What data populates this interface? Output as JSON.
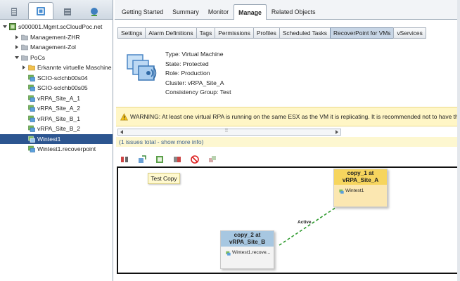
{
  "navigator": {
    "tree": [
      {
        "label": "s000001.Mgmt.scCloudPoc.net",
        "depth": 0,
        "twisty": "open",
        "icon": "vcenter-icon"
      },
      {
        "label": "Management-ZHR",
        "depth": 1,
        "twisty": "closed",
        "icon": "folder-gray-icon"
      },
      {
        "label": "Management-Zol",
        "depth": 1,
        "twisty": "closed",
        "icon": "folder-gray-icon"
      },
      {
        "label": "PoCs",
        "depth": 1,
        "twisty": "open",
        "icon": "folder-gray-icon"
      },
      {
        "label": "Erkannte virtuelle Maschine",
        "depth": 2,
        "twisty": "closed",
        "icon": "folder-yellow-icon"
      },
      {
        "label": "SCIO-sclchb00s04",
        "depth": 2,
        "twisty": "none",
        "icon": "vm-icon"
      },
      {
        "label": "SCIO-sclchb00s05",
        "depth": 2,
        "twisty": "none",
        "icon": "vm-icon"
      },
      {
        "label": "vRPA_Site_A_1",
        "depth": 2,
        "twisty": "none",
        "icon": "vm-icon"
      },
      {
        "label": "vRPA_Site_A_2",
        "depth": 2,
        "twisty": "none",
        "icon": "vm-icon"
      },
      {
        "label": "vRPA_Site_B_1",
        "depth": 2,
        "twisty": "none",
        "icon": "vm-icon"
      },
      {
        "label": "vRPA_Site_B_2",
        "depth": 2,
        "twisty": "none",
        "icon": "vm-icon"
      },
      {
        "label": "Wintest1",
        "depth": 2,
        "twisty": "none",
        "icon": "vm-icon",
        "selected": true
      },
      {
        "label": "Wintest1.recoverpoint",
        "depth": 2,
        "twisty": "none",
        "icon": "vm-icon"
      }
    ]
  },
  "tabs": [
    "Getting Started",
    "Summary",
    "Monitor",
    "Manage",
    "Related Objects"
  ],
  "active_tab": "Manage",
  "subtabs": [
    "Settings",
    "Alarm Definitions",
    "Tags",
    "Permissions",
    "Profiles",
    "Scheduled Tasks",
    "RecoverPoint for VMs",
    "vServices"
  ],
  "active_subtab": "RecoverPoint for VMs",
  "details": {
    "type": "Type:  Virtual Machine",
    "state": "State:  Protected",
    "role": "Role:  Production",
    "cluster": "Cluster:  vRPA_Site_A",
    "group": "Consistency Group:  Test"
  },
  "warning": {
    "text": "WARNING: At least one virtual RPA is running on the same ESX as the VM it is replicating. It is recommended not to have the v",
    "issues": "(1 issues total - show more info)"
  },
  "diagram": {
    "callout": "Test Copy",
    "copy_a": {
      "title_line1": "copy_1 at",
      "title_line2": "vRPA_Site_A",
      "vm": "Wintest1"
    },
    "copy_b": {
      "title_line1": "copy_2 at",
      "title_line2": "vRPA_Site_B",
      "vm": "Wintest1.recove..."
    },
    "link_label": "Active",
    "link_color": "#2e9a2e"
  },
  "colors": {
    "selection": "#2c5590",
    "warning_bg": "#fff6c6",
    "copy_a_header": "#f6d55e",
    "copy_b_header": "#a7c7e1"
  }
}
